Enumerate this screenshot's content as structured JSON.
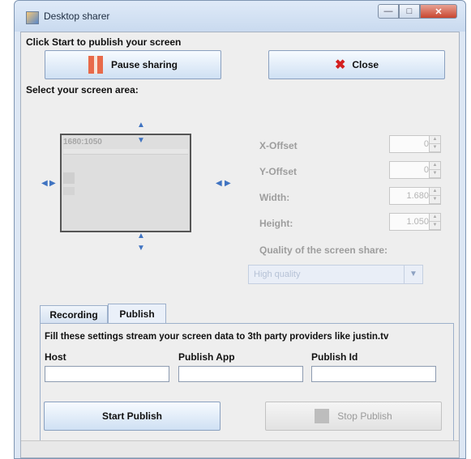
{
  "window": {
    "title": "Desktop sharer"
  },
  "main": {
    "intro_label": "Click Start to publish your screen",
    "pause_button_label": "Pause sharing",
    "close_button_label": "Close",
    "screen_area_label": "Select your screen area:",
    "preview_resolution": "1680:1050"
  },
  "settings": {
    "x_offset_label": "X-Offset",
    "x_offset_value": "0",
    "y_offset_label": "Y-Offset",
    "y_offset_value": "0",
    "width_label": "Width:",
    "width_value": "1.680",
    "height_label": "Height:",
    "height_value": "1.050",
    "quality_label": "Quality of the screen share:",
    "quality_value": "High quality"
  },
  "tabs": [
    {
      "label": "Recording",
      "active": false
    },
    {
      "label": "Publish",
      "active": true
    }
  ],
  "publish": {
    "description": "Fill these settings stream your screen data to 3th party providers like justin.tv",
    "host_label": "Host",
    "host_value": "",
    "app_label": "Publish App",
    "app_value": "",
    "id_label": "Publish Id",
    "id_value": "",
    "start_button_label": "Start Publish",
    "stop_button_label": "Stop Publish"
  },
  "colors": {
    "accent": "#3f73c1",
    "close_icon": "#d41f1f",
    "pause_icon": "#e86a4a"
  }
}
